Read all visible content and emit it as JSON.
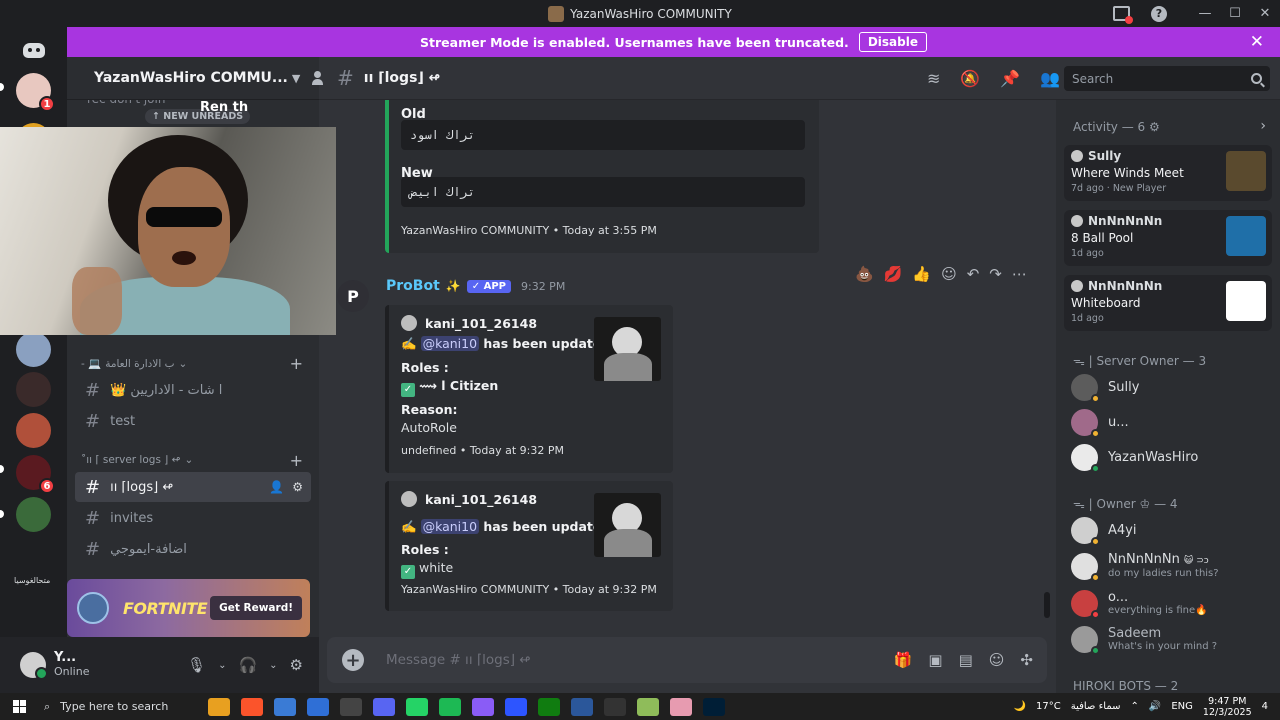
{
  "window": {
    "title": "YazanWasHiro COMMUNITY"
  },
  "banner": {
    "text": "Streamer Mode is enabled. Usernames have been truncated.",
    "button": "Disable"
  },
  "rail": {
    "badges": [
      "1",
      "6"
    ],
    "bottom_label": "متحالغوسيا"
  },
  "sidebar": {
    "guild_name": "YazanWasHiro COMMU...",
    "peek_text": "rec don't join",
    "new_unreads": "NEW UNREADS",
    "category1": "ب الادارة العامة",
    "category1_prefix": "- 💻",
    "category2": "˚ıı ⌈ server logs ⌋ ↫",
    "channels": [
      {
        "label": "👑 ا شات - الاداريين"
      },
      {
        "label": "test"
      },
      {
        "label": "ıı ⌈logs⌋ ↫"
      },
      {
        "label": "invites"
      },
      {
        "label": "اضافة-ايموجي"
      }
    ]
  },
  "webcam": {
    "overlay_text": "Ren th"
  },
  "promo": {
    "logo": "FORTNITE",
    "button": "Get Reward!"
  },
  "user": {
    "name": "Y...",
    "status": "Online"
  },
  "header": {
    "channel": "ıı ⌈logs⌋ ↫",
    "search_placeholder": "Search"
  },
  "embed1": {
    "old_label": "Old",
    "old_value": "تراك اسود",
    "new_label": "New",
    "new_value": "تراك ابيض",
    "footer": "YazanWasHiro COMMUNITY • Today at 3:55 PM"
  },
  "message": {
    "avatar_letter": "P",
    "author": "ProBot",
    "sparkle": "✨",
    "tag": "✓ APP",
    "time": "9:32 PM",
    "reactions": [
      "💩",
      "💋",
      "👍"
    ]
  },
  "embed2": {
    "author": "kani_101_26148",
    "line1_pre": "✍️",
    "mention": "@kani10",
    "line1_post": " has been updated.",
    "roles_label": "Roles :",
    "roles_value": "⟿ ا Citizen",
    "reason_label": "Reason:",
    "reason_value": "AutoRole",
    "footer": "undefined • Today at 9:32 PM"
  },
  "embed3": {
    "author": "kani_101_26148",
    "line1_pre": "✍️",
    "mention": "@kani10",
    "line1_post": " has been updated.",
    "roles_label": "Roles :",
    "roles_value": "white",
    "footer": "YazanWasHiro COMMUNITY • Today at 9:32 PM"
  },
  "composer": {
    "placeholder": "Message # ıı ⌈logs⌋ ↫"
  },
  "members": {
    "activity_title": "Activity — 6 ⚙",
    "activities": [
      {
        "user": "Sully",
        "activity": "Where Winds Meet",
        "time": "7d ago",
        "extra": "New Player",
        "color": "#5a4a2e"
      },
      {
        "user": "NnNnNnNn",
        "activity": "8 Ball Pool",
        "time": "1d ago",
        "extra": "",
        "color": "#1f6fa8"
      },
      {
        "user": "NnNnNnNn",
        "activity": "Whiteboard",
        "time": "1d ago",
        "extra": "",
        "color": "#ffffff"
      }
    ],
    "section1": "ᯓ | Server Owner — 3",
    "owners": [
      {
        "name": "Sully",
        "color": "#5c5c5c",
        "status": "#f0b232"
      },
      {
        "name": "u...",
        "color": "#a06a8a",
        "status": "#f0b232"
      },
      {
        "name": "YazanWasHiro",
        "color": "#eaeaea",
        "status": "#23a55a"
      }
    ],
    "section2": "ᯓ | Owner ♔ — 4",
    "others": [
      {
        "name": "A4yi",
        "sub": "",
        "color": "#cfcfcf",
        "status": "#f0b232"
      },
      {
        "name": "NnNnNnNn",
        "badge": "😺 ⊃ɔ",
        "sub": "do my ladies run this?",
        "color": "#e0e0e0",
        "status": "#f0b232"
      },
      {
        "name": "o...",
        "sub": "everything is fine🔥",
        "color": "#c84040",
        "status": "#f23f43"
      },
      {
        "name": "Sadeem",
        "sub": "What's in your mind ?",
        "color": "#9a9a9a",
        "status": "#23a55a"
      }
    ],
    "section3": "HIROKI BOTS — 2"
  },
  "taskbar": {
    "search": "Type here to search",
    "weather": "17°C",
    "weather_text": "سماء صافية",
    "lang": "ENG",
    "time": "9:47 PM",
    "date": "12/3/2025",
    "notif": "4"
  }
}
